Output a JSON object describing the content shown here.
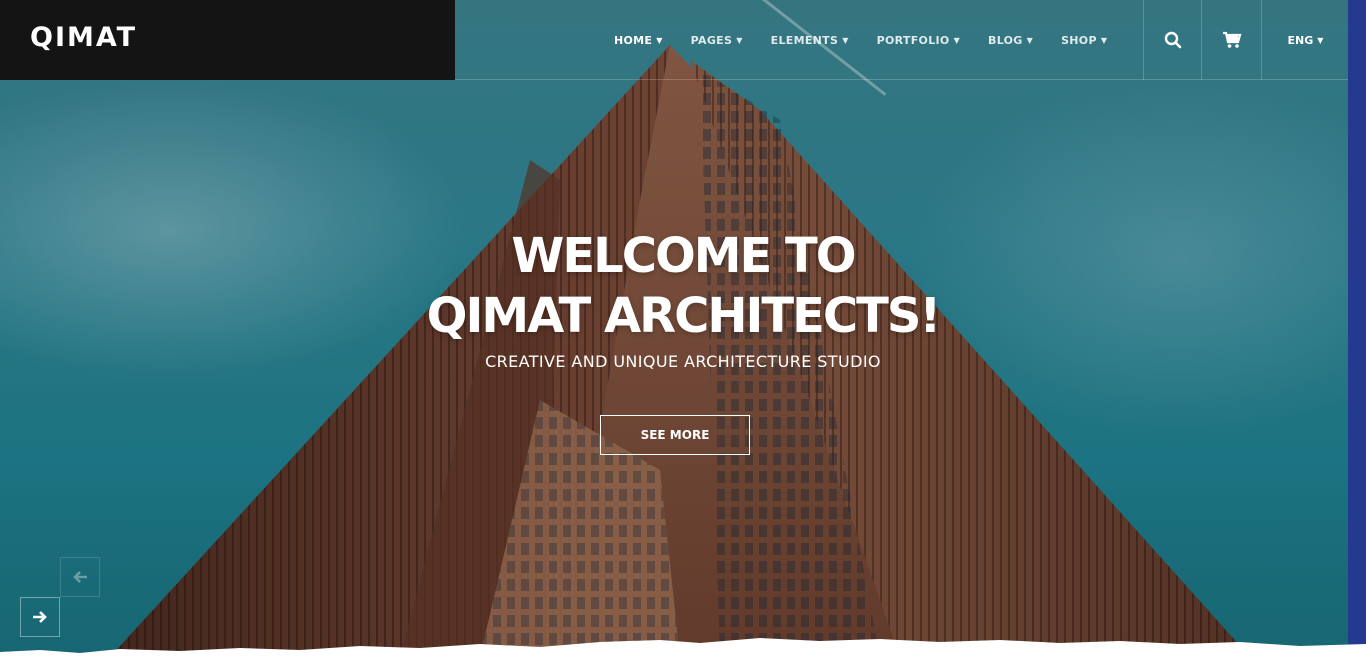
{
  "brand": {
    "logo": "QIMAT"
  },
  "nav": {
    "items": [
      {
        "label": "HOME",
        "active": true
      },
      {
        "label": "PAGES"
      },
      {
        "label": "ELEMENTS"
      },
      {
        "label": "PORTFOLIO"
      },
      {
        "label": "BLOG"
      },
      {
        "label": "SHOP"
      }
    ],
    "chevron": "chevron-down-icon"
  },
  "tools": {
    "search_icon": "search-icon",
    "cart_icon": "cart-icon",
    "language": "ENG"
  },
  "hero": {
    "headline_line1": "WELCOME TO",
    "headline_line2": "QIMAT ARCHITECTS!",
    "subheadline": "CREATIVE AND UNIQUE ARCHITECTURE STUDIO",
    "cta_label": "SEE MORE"
  },
  "slider": {
    "prev_icon": "arrow-left-icon",
    "next_icon": "arrow-right-icon"
  },
  "colors": {
    "sky": "#2f8292",
    "building": "#7a4a3a",
    "brand_box": "#141414",
    "accent_strip": "#243a8e"
  }
}
